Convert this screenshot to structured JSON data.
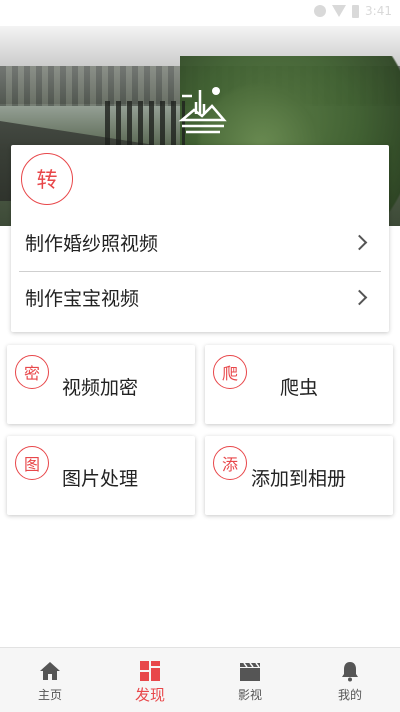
{
  "status_bar": {
    "time": "3:41"
  },
  "main_card": {
    "badge": "转",
    "rows": [
      {
        "label": "制作婚纱照视频"
      },
      {
        "label": "制作宝宝视频"
      }
    ]
  },
  "tiles": [
    {
      "badge": "密",
      "label": "视频加密"
    },
    {
      "badge": "爬",
      "label": "爬虫"
    },
    {
      "badge": "图",
      "label": "图片处理"
    },
    {
      "badge": "添",
      "label": "添加到相册"
    }
  ],
  "bottom_nav": {
    "items": [
      {
        "label": "主页",
        "icon": "home-icon"
      },
      {
        "label": "发现",
        "icon": "discover-icon",
        "active": true
      },
      {
        "label": "影视",
        "icon": "clapperboard-icon"
      },
      {
        "label": "我的",
        "icon": "bell-icon"
      }
    ]
  },
  "colors": {
    "accent": "#e8474a",
    "nav_inactive": "#555555",
    "nav_background": "#f6f6f6"
  }
}
